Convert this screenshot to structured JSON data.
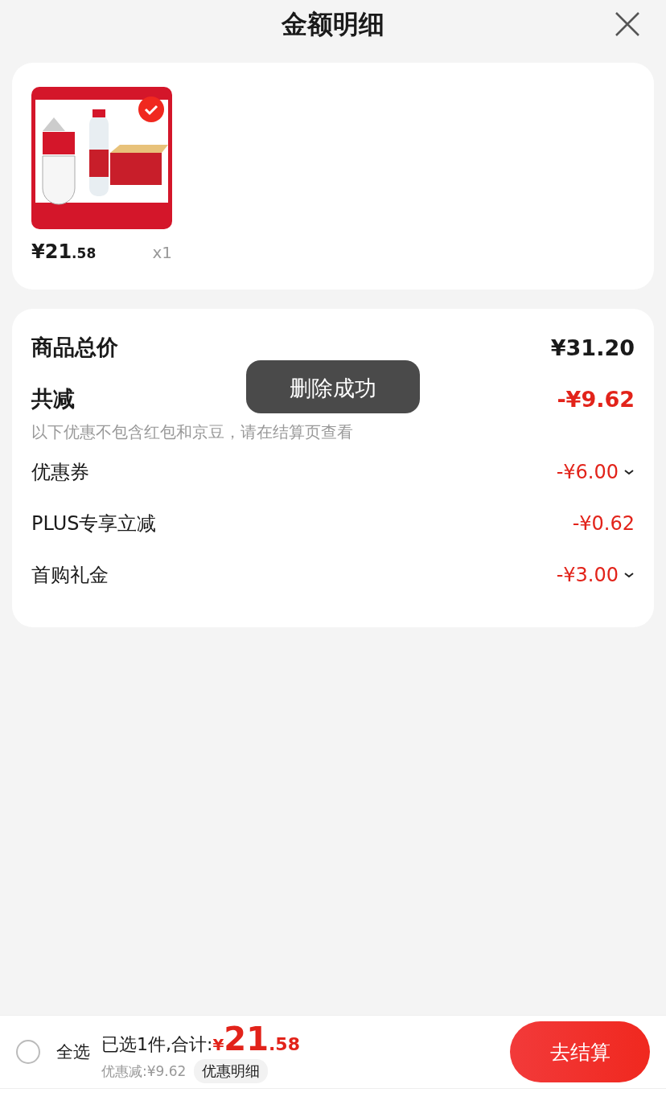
{
  "header": {
    "title": "金额明细"
  },
  "product": {
    "selected": true,
    "price": "¥21.58",
    "quantity": "x1"
  },
  "summary": {
    "total_label": "商品总价",
    "total_value": "¥31.20",
    "discount_label": "共减",
    "discount_value": "-¥9.62",
    "note": "以下优惠不包含红包和京豆，请在结算页查看",
    "items": [
      {
        "label": "优惠券",
        "value": "-¥6.00",
        "kind": "expandable"
      },
      {
        "label": "PLUS专享立减",
        "value": "-¥0.62",
        "kind": "plain"
      },
      {
        "label": "首购礼金",
        "value": "-¥3.00",
        "kind": "expandable"
      }
    ]
  },
  "toast": "删除成功",
  "footer": {
    "select_all": {
      "label": "全选",
      "checked": false
    },
    "selected_text": "已选1件,合计:",
    "total": "¥21.58",
    "discount_text": "优惠减:¥9.62",
    "detail_button": "优惠明细",
    "checkout_button": "去结算"
  }
}
